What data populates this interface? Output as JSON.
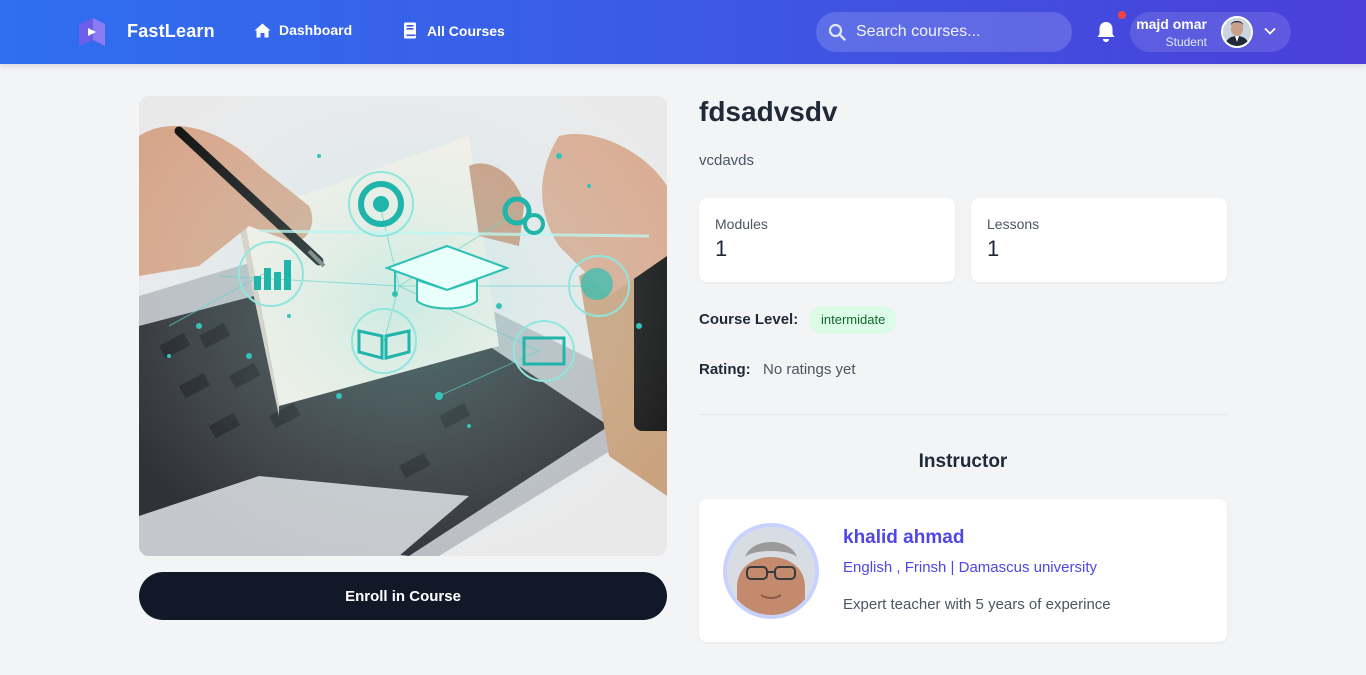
{
  "header": {
    "brand": "FastLearn",
    "nav": [
      {
        "label": "Dashboard",
        "icon": "home-icon"
      },
      {
        "label": "All Courses",
        "icon": "book-icon"
      }
    ],
    "search": {
      "placeholder": "Search courses..."
    },
    "notifications": {
      "has_unread": true
    },
    "user": {
      "name": "majd omar",
      "role": "Student"
    }
  },
  "course": {
    "title": "fdsadvsdv",
    "description": "vcdavds",
    "stats": [
      {
        "label": "Modules",
        "value": "1"
      },
      {
        "label": "Lessons",
        "value": "1"
      }
    ],
    "level_label": "Course Level:",
    "level": "intermidate",
    "rating_label": "Rating:",
    "rating": "No ratings yet",
    "enroll_label": "Enroll in Course"
  },
  "instructor": {
    "heading": "Instructor",
    "name": "khalid ahmad",
    "subtitle": "English , Frinsh | Damascus university",
    "bio": "Expert teacher with 5 years of experince"
  },
  "colors": {
    "header_gradient_start": "#2f6ff0",
    "header_gradient_end": "#4a3fd9",
    "accent": "#4f46e5",
    "button_dark": "#111827",
    "level_badge_bg": "#dcfce7",
    "notification_dot": "#ef4444"
  }
}
